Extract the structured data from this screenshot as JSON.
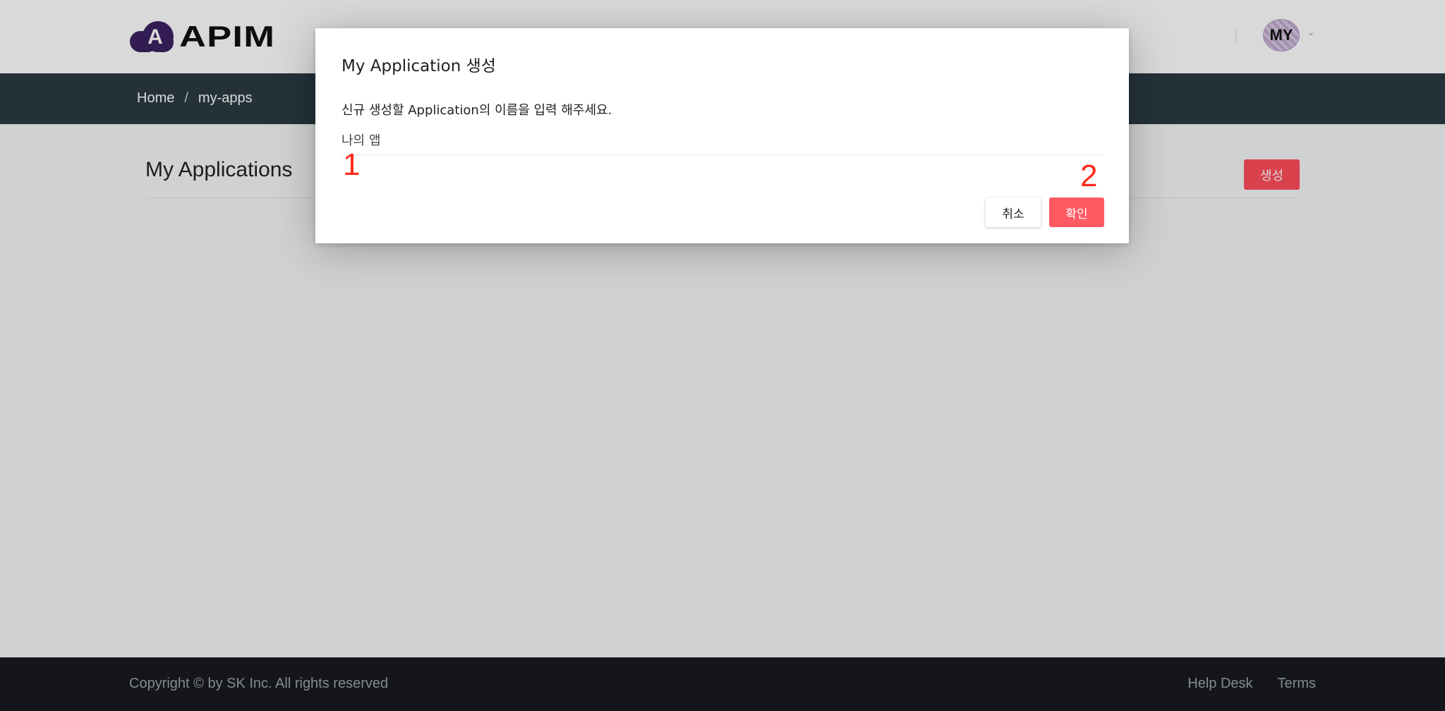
{
  "header": {
    "logo_text": "APIM",
    "logo_glyph": "A",
    "avatar_text": "MY",
    "avatar_caret": "⌄"
  },
  "breadcrumb": {
    "items": [
      "Home",
      "my-apps"
    ],
    "separator": "/"
  },
  "main": {
    "page_title": "My Applications",
    "create_button": "생성"
  },
  "modal": {
    "title": "My Application 생성",
    "description": "신규 생성할 Application의 이름을 입력 해주세요.",
    "input_value": "나의 앱",
    "cancel_label": "취소",
    "confirm_label": "확인"
  },
  "annotations": {
    "marker_1": "1",
    "marker_2": "2"
  },
  "footer": {
    "copyright": "Copyright © by SK Inc. All rights reserved",
    "links": [
      "Help Desk",
      "Terms"
    ]
  },
  "colors": {
    "accent": "#ff4d5a",
    "breadcrumb_bar": "#2b3a44",
    "footer": "#181b20",
    "logo": "#3d2260",
    "marker": "#ff2a1a"
  }
}
